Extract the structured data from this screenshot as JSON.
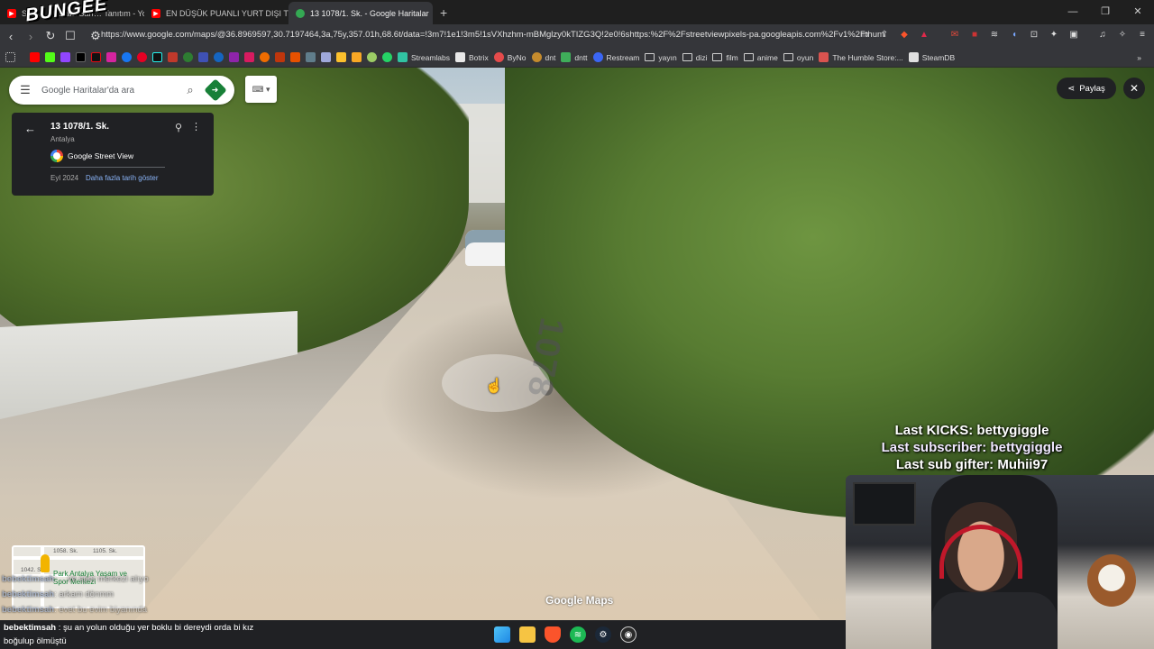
{
  "browser": {
    "tabs": [
      {
        "label": "SAV… Mustafa Sarı… Tanıtım - Yo",
        "color": "#ff0000"
      },
      {
        "label": "EN DÜŞÜK PUANLI YURT DIŞI TURU",
        "color": "#ff0000"
      },
      {
        "label": "13 1078/1. Sk. - Google Haritalar",
        "color": "#34a853"
      }
    ],
    "new_tab": "+",
    "url": "https://www.google.com/maps/@36.8969597,30.7197464,3a,75y,357.01h,68.6t/data=!3m7!1e1!3m5!1sVXhzhm-mBMglzy0kTIZG3Q!2e0!6shttps:%2F%2Fstreetviewpixels-pa.googleapis.com%2Fv1%2Fthumbnail...",
    "bookmarks": [
      {
        "label": "Streamlabs",
        "color": "#31c3a2"
      },
      {
        "label": "Botrix",
        "color": "#e8e8e8"
      },
      {
        "label": "ByNo",
        "color": "#e54b4b"
      },
      {
        "label": "dnt",
        "color": "#c58b2d"
      },
      {
        "label": "dntt",
        "color": "#3fae5a"
      },
      {
        "label": "Restream",
        "color": "#3b66f5"
      },
      {
        "label": "yayın",
        "color": "folder"
      },
      {
        "label": "dizi",
        "color": "folder"
      },
      {
        "label": "film",
        "color": "folder"
      },
      {
        "label": "anime",
        "color": "folder"
      },
      {
        "label": "oyun",
        "color": "folder"
      },
      {
        "label": "The Humble Store:...",
        "color": "#d9534f"
      },
      {
        "label": "SteamDB",
        "color": "#e0e0e0"
      }
    ]
  },
  "maps": {
    "search_placeholder": "Google Haritalar'da ara",
    "info_title": "13 1078/1. Sk.",
    "info_subtitle": "Antalya",
    "provider": "Google Street View",
    "date": "Eyl 2024",
    "more_dates": "Daha fazla tarih göster",
    "share": "Paylaş",
    "watermark": "Google Maps",
    "road_marking": "1078",
    "minimap": {
      "labels": [
        "1058. Sk.",
        "1105. Sk.",
        "1042. Sk."
      ],
      "park": "Park Antalya Yaşam ve Spor Merkezi"
    }
  },
  "stream": {
    "logo": "BUNGEE",
    "last_kicks": "Last KICKS: bettygiggle",
    "last_subscriber": "Last subscriber: bettygiggle",
    "last_sub_gifter": "Last sub gifter: Muhii97",
    "faded_chat": [
      {
        "user": "bebektimsah",
        "text": ": …ve spor merkezi alıyo"
      },
      {
        "user": "bebektimsah",
        "text": ": arkam dönmm"
      },
      {
        "user": "bebektimsah",
        "text": ": evet bu evim biyanında"
      }
    ],
    "chat_user": "bebektimsah",
    "chat_text_line1": ": şu an yolun olduğu yer boklu bi dereydi orda bi kız",
    "chat_text_line2": "boğulup ölmüştü"
  },
  "icons": {
    "menu": "hamburger-icon",
    "search": "search-icon",
    "directions": "directions-icon",
    "back": "arrow-left-icon",
    "pin": "pin-icon",
    "more": "more-vert-icon",
    "share": "share-icon",
    "close": "close-icon"
  }
}
